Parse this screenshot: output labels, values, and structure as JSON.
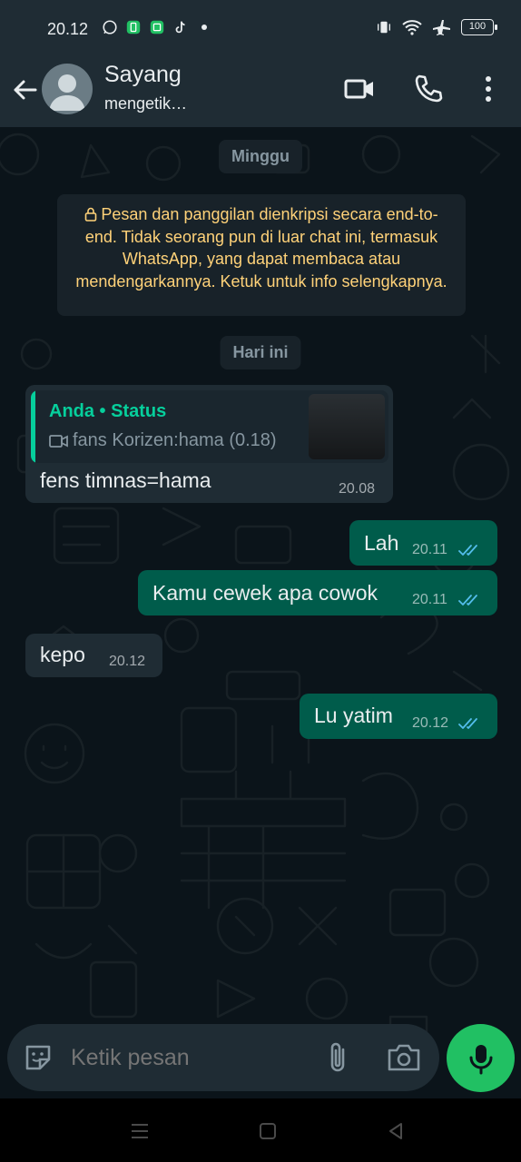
{
  "status_bar": {
    "time": "20.12",
    "battery": "100"
  },
  "header": {
    "contact_name": "Sayang",
    "contact_status": "mengetik…"
  },
  "chat": {
    "date_chip_1": "Minggu",
    "encryption_notice": "Pesan dan panggilan dienkripsi secara end-to-end. Tidak seorang pun di luar chat ini, termasuk WhatsApp, yang dapat membaca atau mendengarkannya. Ketuk untuk info selengkapnya.",
    "date_chip_2": "Hari ini",
    "messages": [
      {
        "direction": "in",
        "quote_author": "Anda • Status",
        "quote_text": "fans Korizen:hama (0.18)",
        "text": "fens timnas=hama",
        "time": "20.08"
      },
      {
        "direction": "out",
        "text": "Lah",
        "time": "20.11",
        "read": true
      },
      {
        "direction": "out",
        "text": "Kamu cewek apa cowok",
        "time": "20.11",
        "read": true
      },
      {
        "direction": "in",
        "text": "kepo",
        "time": "20.12"
      },
      {
        "direction": "out",
        "text": "Lu yatim",
        "time": "20.12",
        "read": true
      }
    ]
  },
  "input": {
    "placeholder": "Ketik pesan"
  },
  "colors": {
    "accent": "#21c063",
    "outgoing_bubble": "#005c4b",
    "incoming_bubble": "#1f2c34",
    "read_ticks": "#53bdeb",
    "notice_text": "#ffd279"
  }
}
